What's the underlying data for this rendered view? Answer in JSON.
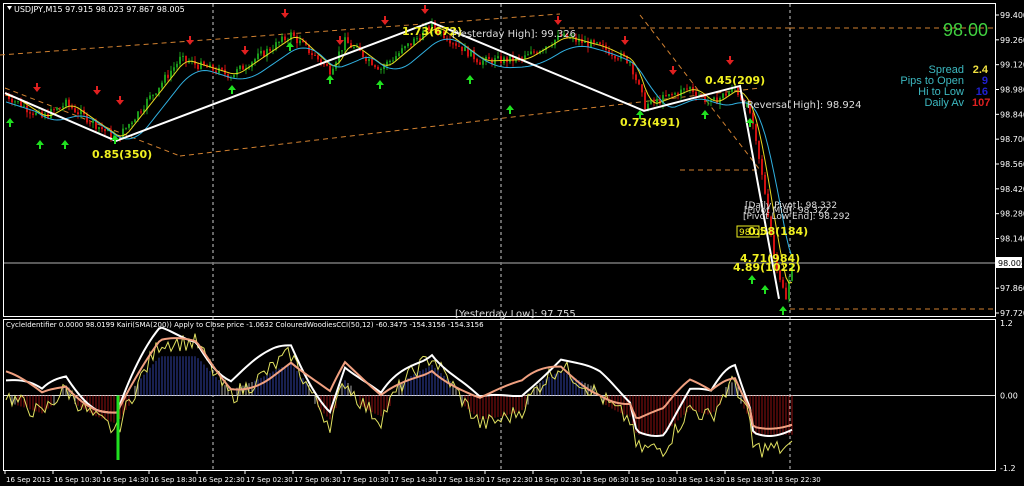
{
  "header": {
    "symbol_info": "USDJPY,M15  97.915 98.023 97.867 98.005"
  },
  "info_panel": {
    "price": "98.00",
    "rows": [
      {
        "label": "Spread",
        "value": "2.4",
        "color": "#f0e040"
      },
      {
        "label": "Pips to Open",
        "value": "9",
        "color": "#2020d0"
      },
      {
        "label": "Hi to Low",
        "value": "16",
        "color": "#2020d0"
      },
      {
        "label": "Daily Av",
        "value": "107",
        "color": "#e02020"
      }
    ]
  },
  "indicator_header": "CycleIdentifier 0.0000 98.0199  Kairi(SMA(200)) Apply to Close price -1.0632  ColouredWoodiesCCI(50,12) -60.3475 -154.3156 -154.3156",
  "chart_data": {
    "type": "candlestick",
    "symbol": "USDJPY",
    "timeframe": "M15",
    "ylim": [
      97.72,
      99.4
    ],
    "y_ticks": [
      "99.400",
      "99.260",
      "99.120",
      "98.980",
      "98.840",
      "98.700",
      "98.560",
      "98.420",
      "98.280",
      "98.140",
      "97.860",
      "97.720"
    ],
    "current_price": "98.005",
    "x_ticks": [
      "16 Sep 2013",
      "16 Sep 10:30",
      "16 Sep 14:30",
      "16 Sep 18:30",
      "16 Sep 22:30",
      "17 Sep 02:30",
      "17 Sep 06:30",
      "17 Sep 10:30",
      "17 Sep 14:30",
      "17 Sep 18:30",
      "17 Sep 22:30",
      "18 Sep 02:30",
      "18 Sep 06:30",
      "18 Sep 10:30",
      "18 Sep 14:30",
      "18 Sep 18:30",
      "18 Sep 22:30"
    ],
    "price_path": [
      [
        0,
        98.95
      ],
      [
        12,
        98.82
      ],
      [
        20,
        98.9
      ],
      [
        37,
        98.7
      ],
      [
        58,
        99.15
      ],
      [
        75,
        99.06
      ],
      [
        95,
        99.29
      ],
      [
        108,
        99.09
      ],
      [
        113,
        99.25
      ],
      [
        125,
        99.1
      ],
      [
        142,
        99.34
      ],
      [
        158,
        99.14
      ],
      [
        172,
        99.15
      ],
      [
        185,
        99.28
      ],
      [
        198,
        99.22
      ],
      [
        208,
        99.14
      ],
      [
        213,
        98.89
      ],
      [
        218,
        98.92
      ],
      [
        228,
        98.99
      ],
      [
        235,
        98.9
      ],
      [
        243,
        98.99
      ],
      [
        248,
        98.85
      ],
      [
        253,
        98.4
      ],
      [
        256,
        98.05
      ],
      [
        260,
        97.79
      ],
      [
        262,
        98.0
      ]
    ],
    "zigzag": [
      [
        0,
        98.96
      ],
      [
        37,
        98.69
      ],
      [
        142,
        99.36
      ],
      [
        213,
        98.86
      ],
      [
        245,
        99.0
      ],
      [
        258,
        97.8
      ]
    ],
    "zigzag_labels": [
      "0.85(350)",
      "1.73(672)",
      "0.73(491)",
      "0.45(209)",
      "0.58(184)",
      "4.71(984)",
      "4.89(1022)"
    ],
    "level_labels": [
      "[Yesterday High]: 99.326",
      "[Reversal High]: 98.924",
      "[Yesterday Low]: 97.755",
      "[Daily Pivot]: 98.332",
      "[Pivot Mid]: 98.322",
      "[Pivot Low End]: 98.292"
    ],
    "price_box": "98.01",
    "indicator": {
      "ylim": [
        -1.2,
        1.2
      ],
      "y_ticks": [
        "1.2",
        "0.00",
        "-1.2"
      ]
    }
  }
}
